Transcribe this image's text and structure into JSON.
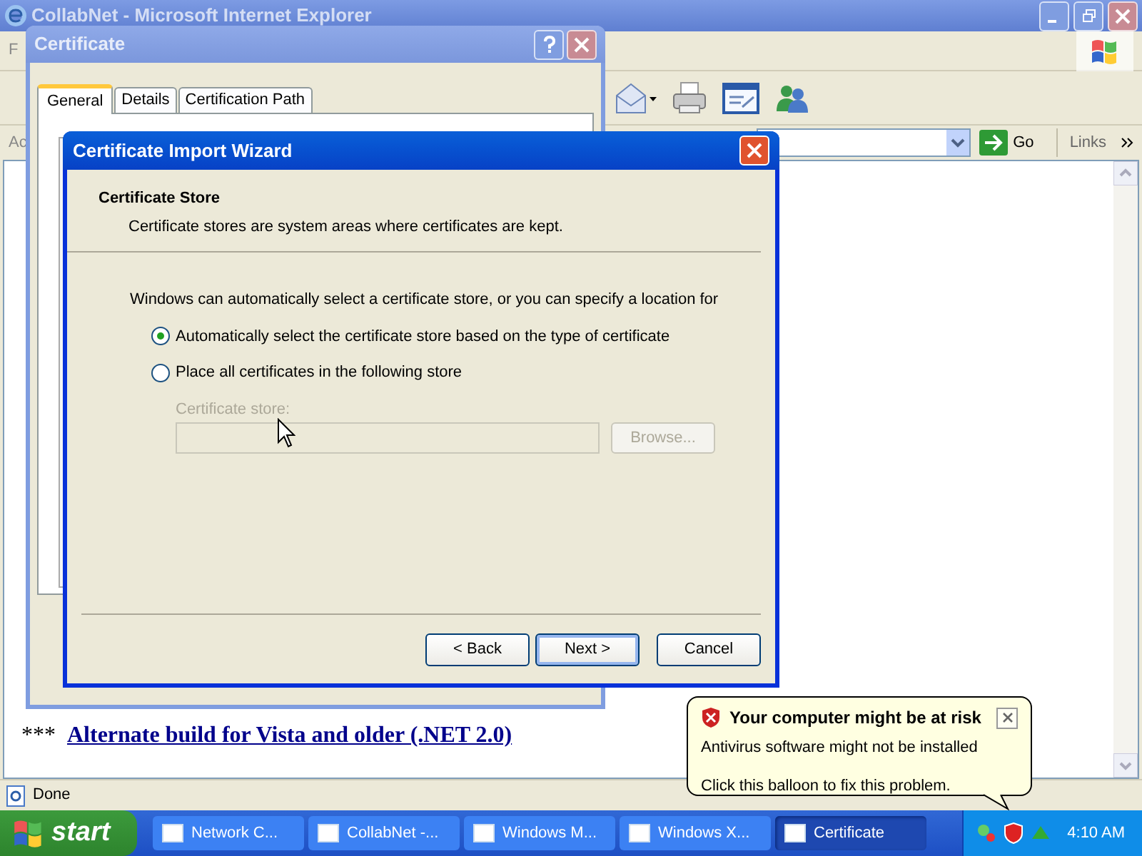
{
  "browser": {
    "title": "CollabNet - Microsoft Internet Explorer",
    "menu_fragment": "F",
    "address_label_fragment": "Ac",
    "go": "Go",
    "links": "Links",
    "link_text": "Alternate build for Vista and older (.NET 2.0)",
    "link_prefix": "***",
    "status": "Done"
  },
  "certificate_dialog": {
    "title": "Certificate",
    "tabs": [
      {
        "label": "General",
        "selected": true
      },
      {
        "label": "Details",
        "selected": false
      },
      {
        "label": "Certification Path",
        "selected": false
      }
    ]
  },
  "wizard": {
    "title": "Certificate Import Wizard",
    "heading": "Certificate Store",
    "subheading": "Certificate stores are system areas where certificates are kept.",
    "intro": "Windows can automatically select a certificate store, or you can specify a location for",
    "options": [
      {
        "label": "Automatically select the certificate store based on the type of certificate",
        "selected": true
      },
      {
        "label": "Place all certificates in the following store",
        "selected": false
      }
    ],
    "store_label": "Certificate store:",
    "store_disabled": true,
    "browse": "Browse...",
    "buttons": [
      "< Back",
      "Next >",
      "Cancel"
    ]
  },
  "balloon": {
    "title": "Your computer might be at risk",
    "lines": [
      "Antivirus software might not be installed",
      "Click this balloon to fix this problem."
    ]
  },
  "taskbar": {
    "start": "start",
    "tasks": [
      {
        "label": "Network C...",
        "selected": false
      },
      {
        "label": "CollabNet -...",
        "selected": false
      },
      {
        "label": "Windows M...",
        "selected": false
      },
      {
        "label": "Windows X...",
        "selected": false
      },
      {
        "label": "Certificate",
        "selected": true
      }
    ],
    "clock": "4:10 AM"
  }
}
